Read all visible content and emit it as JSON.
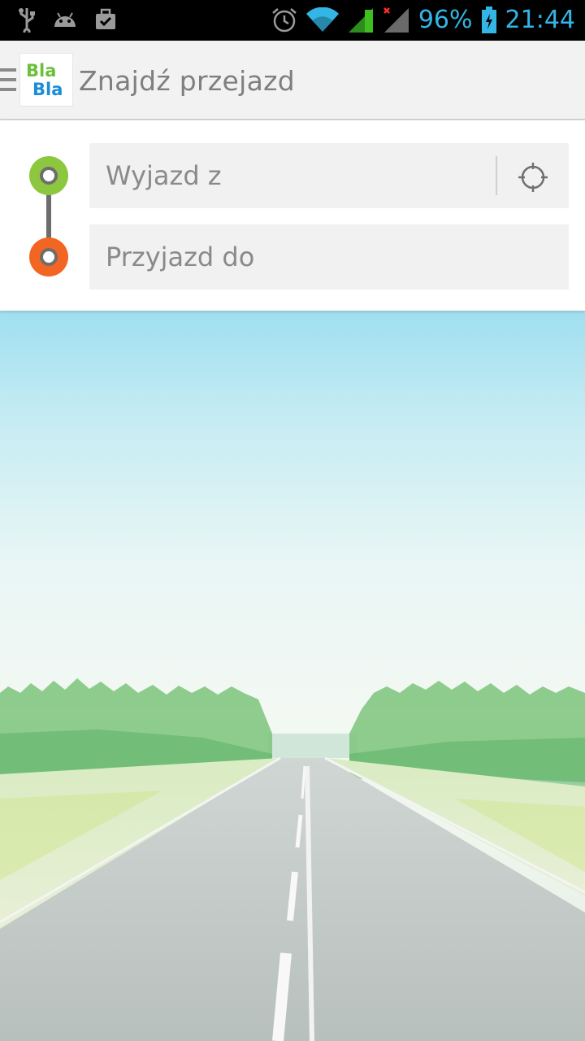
{
  "status_bar": {
    "battery": "96%",
    "time": "21:44",
    "icons": [
      "usb-icon",
      "android-icon",
      "briefcase-icon",
      "alarm-icon",
      "wifi-icon",
      "signal-icon",
      "signal-no-service-icon",
      "battery-charging-icon"
    ]
  },
  "action_bar": {
    "logo_line1": "Bla",
    "logo_line2": "Bla",
    "title": "Znajdź przejazd"
  },
  "search": {
    "from_placeholder": "Wyjazd z",
    "to_placeholder": "Przyjazd do",
    "from_dot_color": "#8dc63f",
    "to_dot_color": "#f26522"
  },
  "background": {
    "description_icon": "road-landscape-image"
  }
}
